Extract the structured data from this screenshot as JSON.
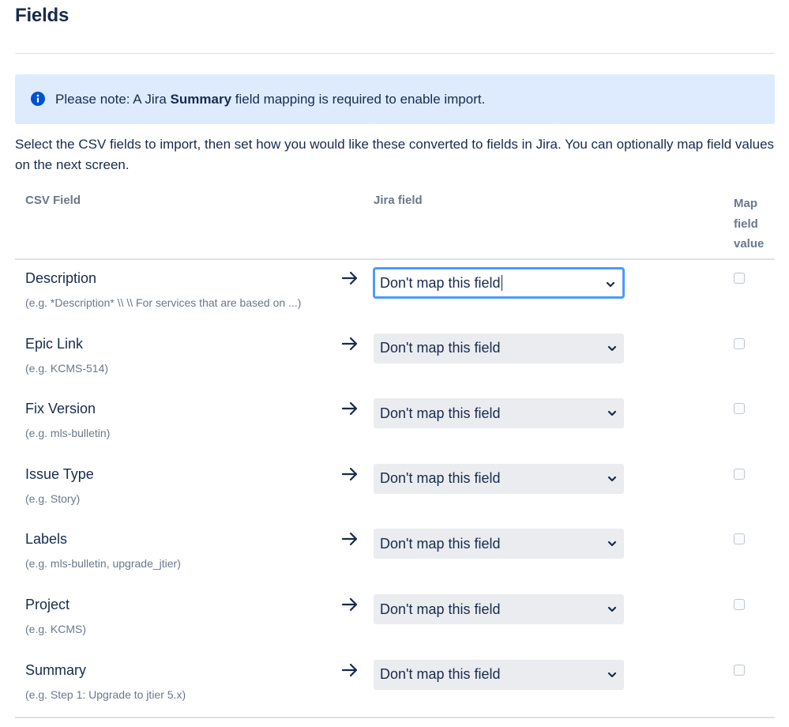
{
  "header": {
    "title": "Fields"
  },
  "notice": {
    "icon": "info-icon",
    "prefix": "Please note: A Jira ",
    "bold": "Summary",
    "suffix": " field mapping is required to enable import.",
    "color": "#deebff"
  },
  "intro": "Select the CSV fields to import, then set how you would like these converted to fields in Jira. You can optionally map field values on the next screen.",
  "table": {
    "headers": {
      "csv": "CSV Field",
      "jira": "Jira field",
      "map": "Map field value"
    },
    "rows": [
      {
        "name": "Description",
        "example": "(e.g. *Description* \\\\ \\\\ For services that are based on ...)",
        "jira_value": "Don't map this field",
        "focused": true,
        "map_checked": false
      },
      {
        "name": "Epic Link",
        "example": "(e.g. KCMS-514)",
        "jira_value": "Don't map this field",
        "focused": false,
        "map_checked": false
      },
      {
        "name": "Fix Version",
        "example": "(e.g. mls-bulletin)",
        "jira_value": "Don't map this field",
        "focused": false,
        "map_checked": false
      },
      {
        "name": "Issue Type",
        "example": "(e.g. Story)",
        "jira_value": "Don't map this field",
        "focused": false,
        "map_checked": false
      },
      {
        "name": "Labels",
        "example": "(e.g. mls-bulletin, upgrade_jtier)",
        "jira_value": "Don't map this field",
        "focused": false,
        "map_checked": false
      },
      {
        "name": "Project",
        "example": "(e.g. KCMS)",
        "jira_value": "Don't map this field",
        "focused": false,
        "map_checked": false
      },
      {
        "name": "Summary",
        "example": "(e.g. Step 1: Upgrade to jtier 5.x)",
        "jira_value": "Don't map this field",
        "focused": false,
        "map_checked": false
      }
    ]
  },
  "colors": {
    "text": "#172b4d",
    "muted": "#6b778c",
    "focus": "#4c9aff",
    "select_bg": "#ebecf0",
    "info_icon": "#0052cc"
  }
}
